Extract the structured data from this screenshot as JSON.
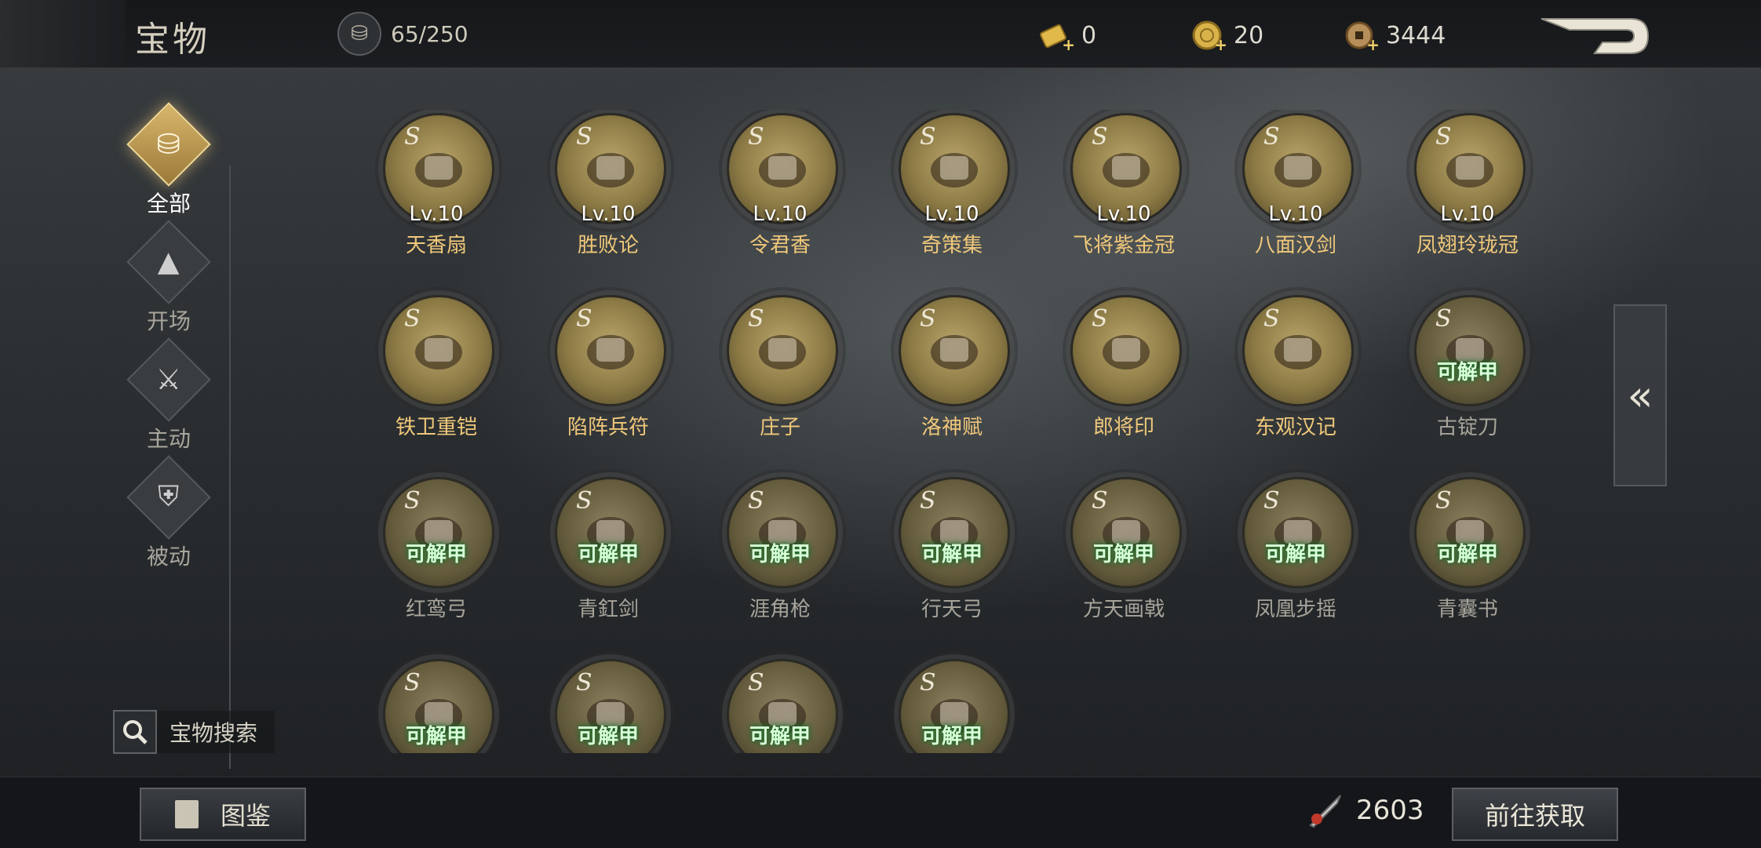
{
  "header": {
    "title": "宝物",
    "capacity": "65/250",
    "currencies": [
      {
        "name": "gold-ingot",
        "value": "0"
      },
      {
        "name": "gold-coin",
        "value": "20"
      },
      {
        "name": "copper-coin",
        "value": "3444"
      }
    ]
  },
  "sidebar": {
    "items": [
      {
        "label": "全部",
        "active": true
      },
      {
        "label": "开场",
        "active": false
      },
      {
        "label": "主动",
        "active": false
      },
      {
        "label": "被动",
        "active": false
      }
    ],
    "search_label": "宝物搜索"
  },
  "treasures": [
    {
      "grade": "S",
      "level": "Lv.10",
      "name": "天香扇",
      "unlock": ""
    },
    {
      "grade": "S",
      "level": "Lv.10",
      "name": "胜败论",
      "unlock": ""
    },
    {
      "grade": "S",
      "level": "Lv.10",
      "name": "令君香",
      "unlock": ""
    },
    {
      "grade": "S",
      "level": "Lv.10",
      "name": "奇策集",
      "unlock": ""
    },
    {
      "grade": "S",
      "level": "Lv.10",
      "name": "飞将紫金冠",
      "unlock": ""
    },
    {
      "grade": "S",
      "level": "Lv.10",
      "name": "八面汉剑",
      "unlock": ""
    },
    {
      "grade": "S",
      "level": "Lv.10",
      "name": "凤翅玲珑冠",
      "unlock": ""
    },
    {
      "grade": "S",
      "level": "",
      "name": "铁卫重铠",
      "unlock": ""
    },
    {
      "grade": "S",
      "level": "",
      "name": "陷阵兵符",
      "unlock": ""
    },
    {
      "grade": "S",
      "level": "",
      "name": "庄子",
      "unlock": ""
    },
    {
      "grade": "S",
      "level": "",
      "name": "洛神赋",
      "unlock": ""
    },
    {
      "grade": "S",
      "level": "",
      "name": "郎将印",
      "unlock": ""
    },
    {
      "grade": "S",
      "level": "",
      "name": "东观汉记",
      "unlock": ""
    },
    {
      "grade": "S",
      "level": "",
      "name": "古锭刀",
      "unlock": "可解甲"
    },
    {
      "grade": "S",
      "level": "",
      "name": "红鸾弓",
      "unlock": "可解甲"
    },
    {
      "grade": "S",
      "level": "",
      "name": "青釭剑",
      "unlock": "可解甲"
    },
    {
      "grade": "S",
      "level": "",
      "name": "涯角枪",
      "unlock": "可解甲"
    },
    {
      "grade": "S",
      "level": "",
      "name": "行天弓",
      "unlock": "可解甲"
    },
    {
      "grade": "S",
      "level": "",
      "name": "方天画戟",
      "unlock": "可解甲"
    },
    {
      "grade": "S",
      "level": "",
      "name": "凤凰步摇",
      "unlock": "可解甲"
    },
    {
      "grade": "S",
      "level": "",
      "name": "青囊书",
      "unlock": "可解甲"
    },
    {
      "grade": "S",
      "level": "",
      "name": "",
      "unlock": "可解甲"
    },
    {
      "grade": "S",
      "level": "",
      "name": "",
      "unlock": "可解甲"
    },
    {
      "grade": "S",
      "level": "",
      "name": "",
      "unlock": "可解甲"
    },
    {
      "grade": "S",
      "level": "",
      "name": "",
      "unlock": "可解甲"
    }
  ],
  "footer": {
    "codex_label": "图鉴",
    "shard_count": "2603",
    "obtain_label": "前往获取"
  }
}
